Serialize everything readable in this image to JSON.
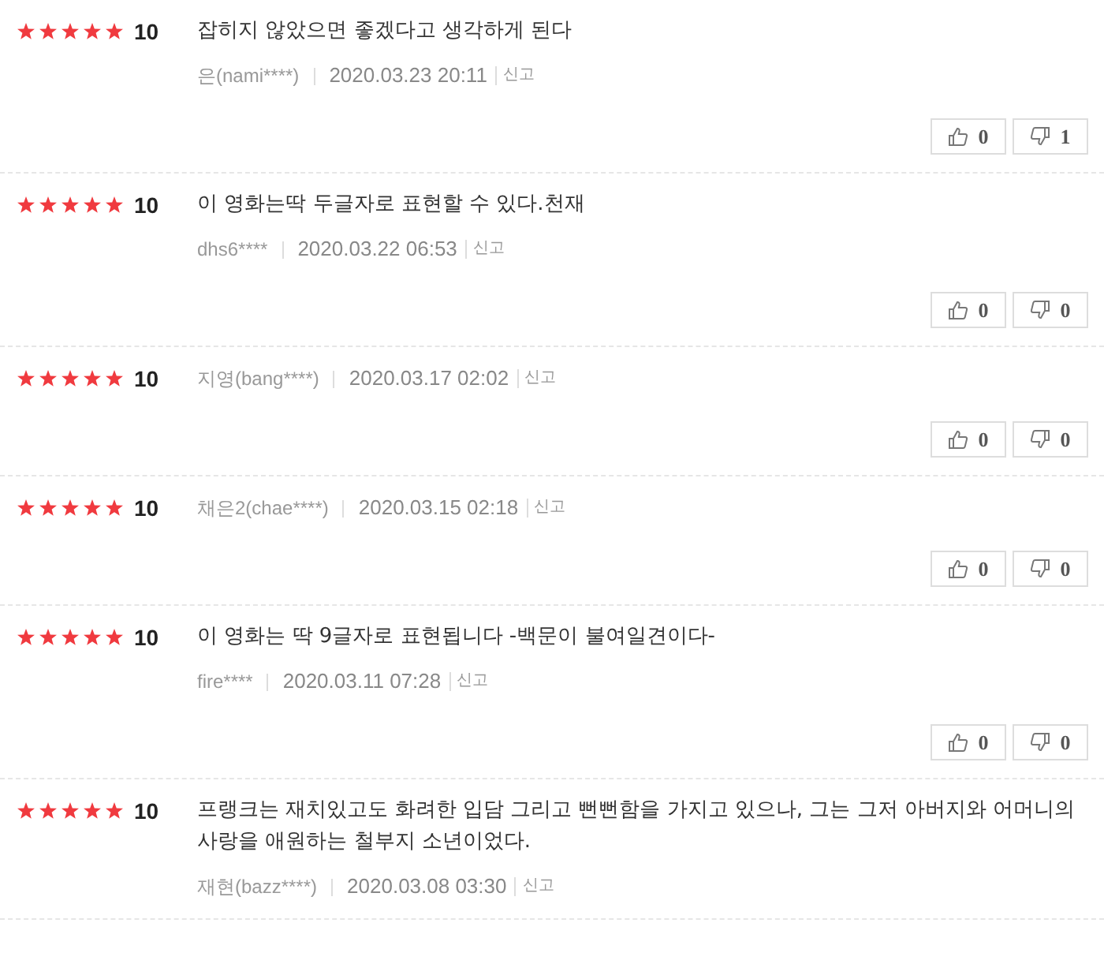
{
  "reviews": [
    {
      "stars": 5,
      "score": "10",
      "text": "잡히지 않았으면 좋겠다고 생각하게 된다",
      "author": "은(nami****)",
      "date": "2020.03.23 20:11",
      "report": "신고",
      "likes": "0",
      "dislikes": "1"
    },
    {
      "stars": 5,
      "score": "10",
      "text": "이 영화는딱 두글자로 표현할 수 있다.천재",
      "author": "dhs6****",
      "date": "2020.03.22 06:53",
      "report": "신고",
      "likes": "0",
      "dislikes": "0"
    },
    {
      "stars": 5,
      "score": "10",
      "author": "지영(bang****)",
      "date": "2020.03.17 02:02",
      "report": "신고",
      "likes": "0",
      "dislikes": "0"
    },
    {
      "stars": 5,
      "score": "10",
      "author": "채은2(chae****)",
      "date": "2020.03.15 02:18",
      "report": "신고",
      "likes": "0",
      "dislikes": "0"
    },
    {
      "stars": 5,
      "score": "10",
      "text": "이 영화는 딱 9글자로 표현됩니다 -백문이 불여일견이다-",
      "author": "fire****",
      "date": "2020.03.11 07:28",
      "report": "신고",
      "likes": "0",
      "dislikes": "0"
    },
    {
      "stars": 5,
      "score": "10",
      "text": "프랭크는 재치있고도 화려한 입담 그리고 뻔뻔함을 가지고 있으나, 그는 그저 아버지와 어머니의 사랑을 애원하는 철부지 소년이었다.",
      "author": "재현(bazz****)",
      "date": "2020.03.08 03:30",
      "report": "신고"
    }
  ]
}
